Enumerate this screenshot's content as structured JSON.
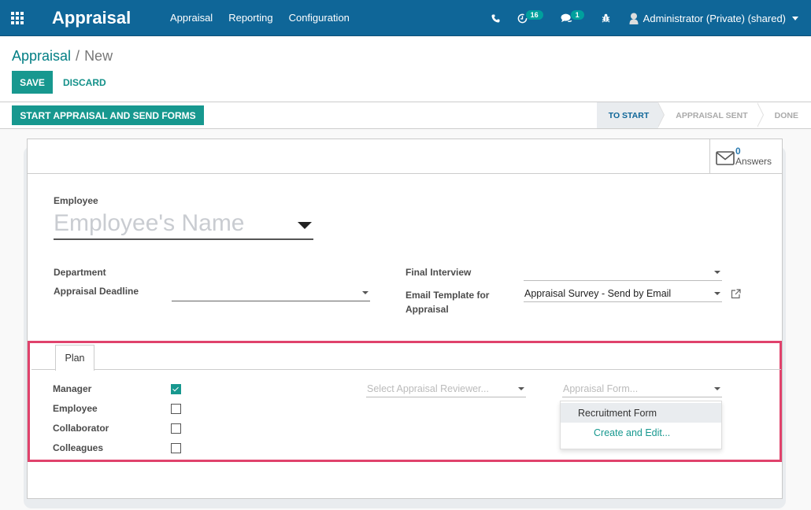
{
  "navbar": {
    "app_name": "Appraisal",
    "menu": [
      "Appraisal",
      "Reporting",
      "Configuration"
    ],
    "icons": {
      "apps": "apps-grid-icon",
      "phone": "phone-icon",
      "activity": "activity-clock-icon",
      "messages": "chat-icon",
      "debug": "bug-icon",
      "user": "user-avatar-icon"
    },
    "activity_count": "16",
    "message_count": "1",
    "user_name": "Administrator (Private) (shared)"
  },
  "breadcrumb": {
    "parent": "Appraisal",
    "separator": "/",
    "current": "New"
  },
  "actions": {
    "save": "SAVE",
    "discard": "DISCARD"
  },
  "statusbar": {
    "start_button": "START APPRAISAL AND SEND FORMS",
    "stages": [
      {
        "label": "TO START",
        "active": true
      },
      {
        "label": "APPRAISAL SENT",
        "active": false
      },
      {
        "label": "DONE",
        "active": false
      }
    ]
  },
  "stat_button": {
    "value": "0",
    "label": "Answers",
    "icon": "envelope-icon"
  },
  "form": {
    "employee_label": "Employee",
    "employee_placeholder": "Employee's Name",
    "department_label": "Department",
    "deadline_label": "Appraisal Deadline",
    "deadline_value": "",
    "final_interview_label": "Final Interview",
    "final_interview_value": "",
    "email_template_label_line1": "Email Template for",
    "email_template_label_line2": "Appraisal",
    "email_template_value": "Appraisal Survey - Send by Email",
    "external_link_icon": "external-link-icon"
  },
  "plan": {
    "tab_label": "Plan",
    "rows": [
      {
        "label": "Manager",
        "checked": true
      },
      {
        "label": "Employee",
        "checked": false
      },
      {
        "label": "Collaborator",
        "checked": false
      },
      {
        "label": "Colleagues",
        "checked": false
      }
    ],
    "reviewer_placeholder": "Select Appraisal Reviewer...",
    "form_placeholder": "Appraisal Form...",
    "dropdown_options": [
      "Recruitment Form"
    ],
    "dropdown_create": "Create and Edit..."
  },
  "colors": {
    "navbar": "#0f6698",
    "primary": "#17988f",
    "highlight": "#e0426c"
  }
}
